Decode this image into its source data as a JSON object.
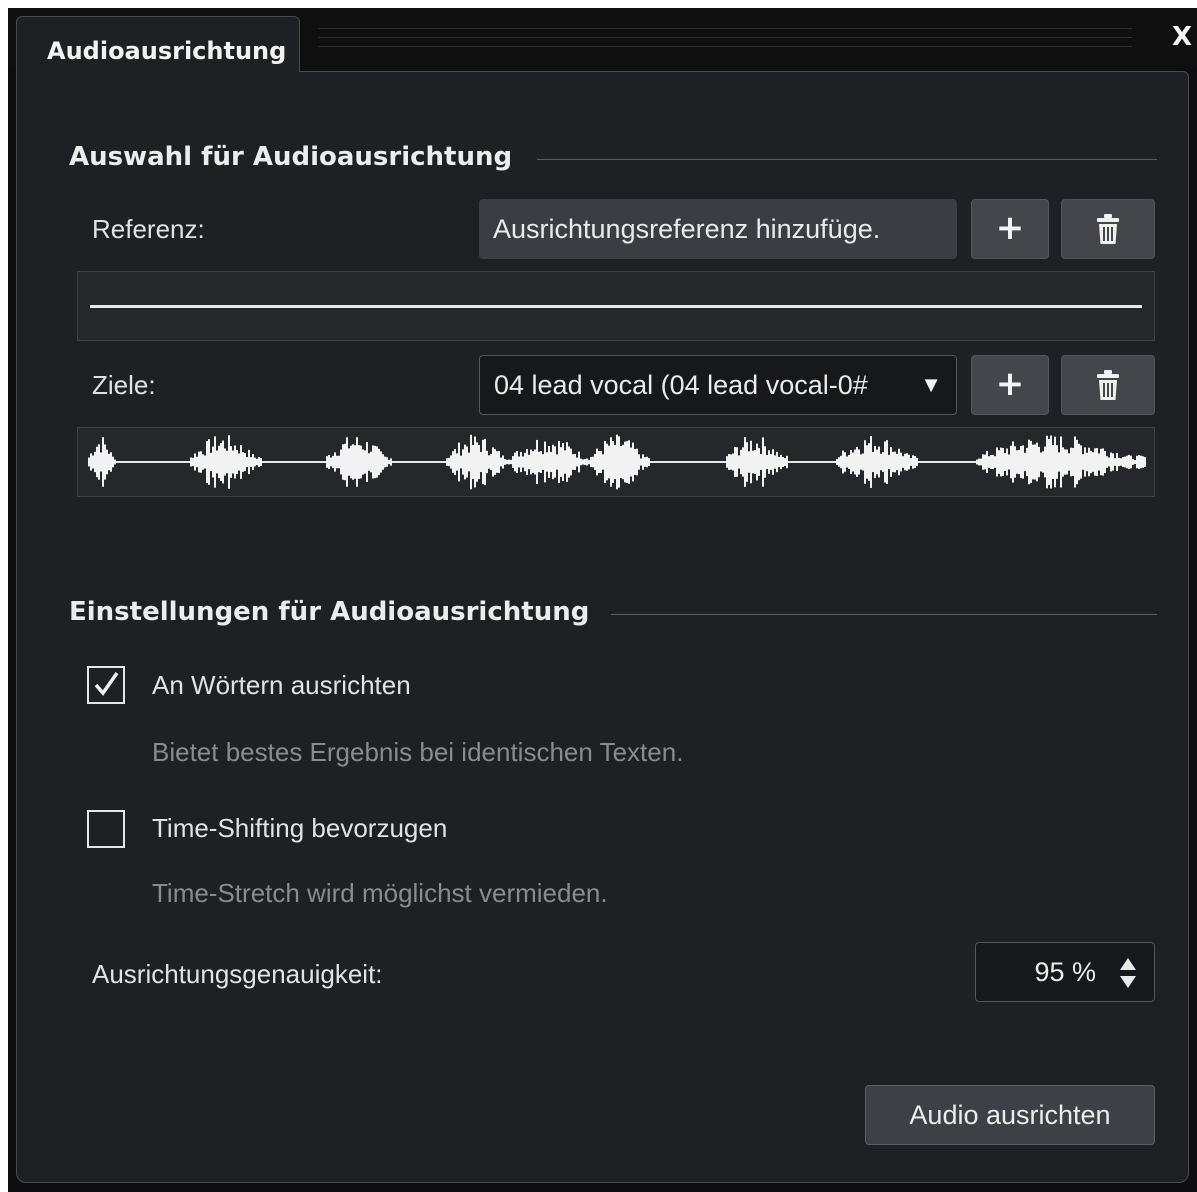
{
  "dialog": {
    "tab_title": "Audioausrichtung",
    "close_label": "X"
  },
  "selection": {
    "title": "Auswahl für Audioausrichtung",
    "reference_label": "Referenz:",
    "reference_value": "Ausrichtungsreferenz hinzufüge.",
    "targets_label": "Ziele:",
    "target_value": "04 lead vocal (04 lead vocal-0#",
    "dropdown_arrow": "▼",
    "add_label": "+",
    "icons": [
      "plus-icon",
      "trash-icon",
      "chevron-down-icon"
    ]
  },
  "settings": {
    "title": "Einstellungen für Audioausrichtung",
    "options": [
      {
        "label": "An Wörtern ausrichten",
        "hint": "Bietet bestes Ergebnis bei identischen Texten.",
        "checked": true
      },
      {
        "label": "Time-Shifting bevorzugen",
        "hint": "Time-Stretch wird möglichst vermieden.",
        "checked": false
      }
    ],
    "precision_label": "Ausrichtungsgenauigkeit:",
    "precision_value": "95 %"
  },
  "actions": {
    "align_label": "Audio ausrichten"
  },
  "colors": {
    "panel": "#1f2024",
    "background": "#0e0e10",
    "text": "#e6e6e6",
    "hint": "#8a8b90",
    "button": "#45464b"
  }
}
